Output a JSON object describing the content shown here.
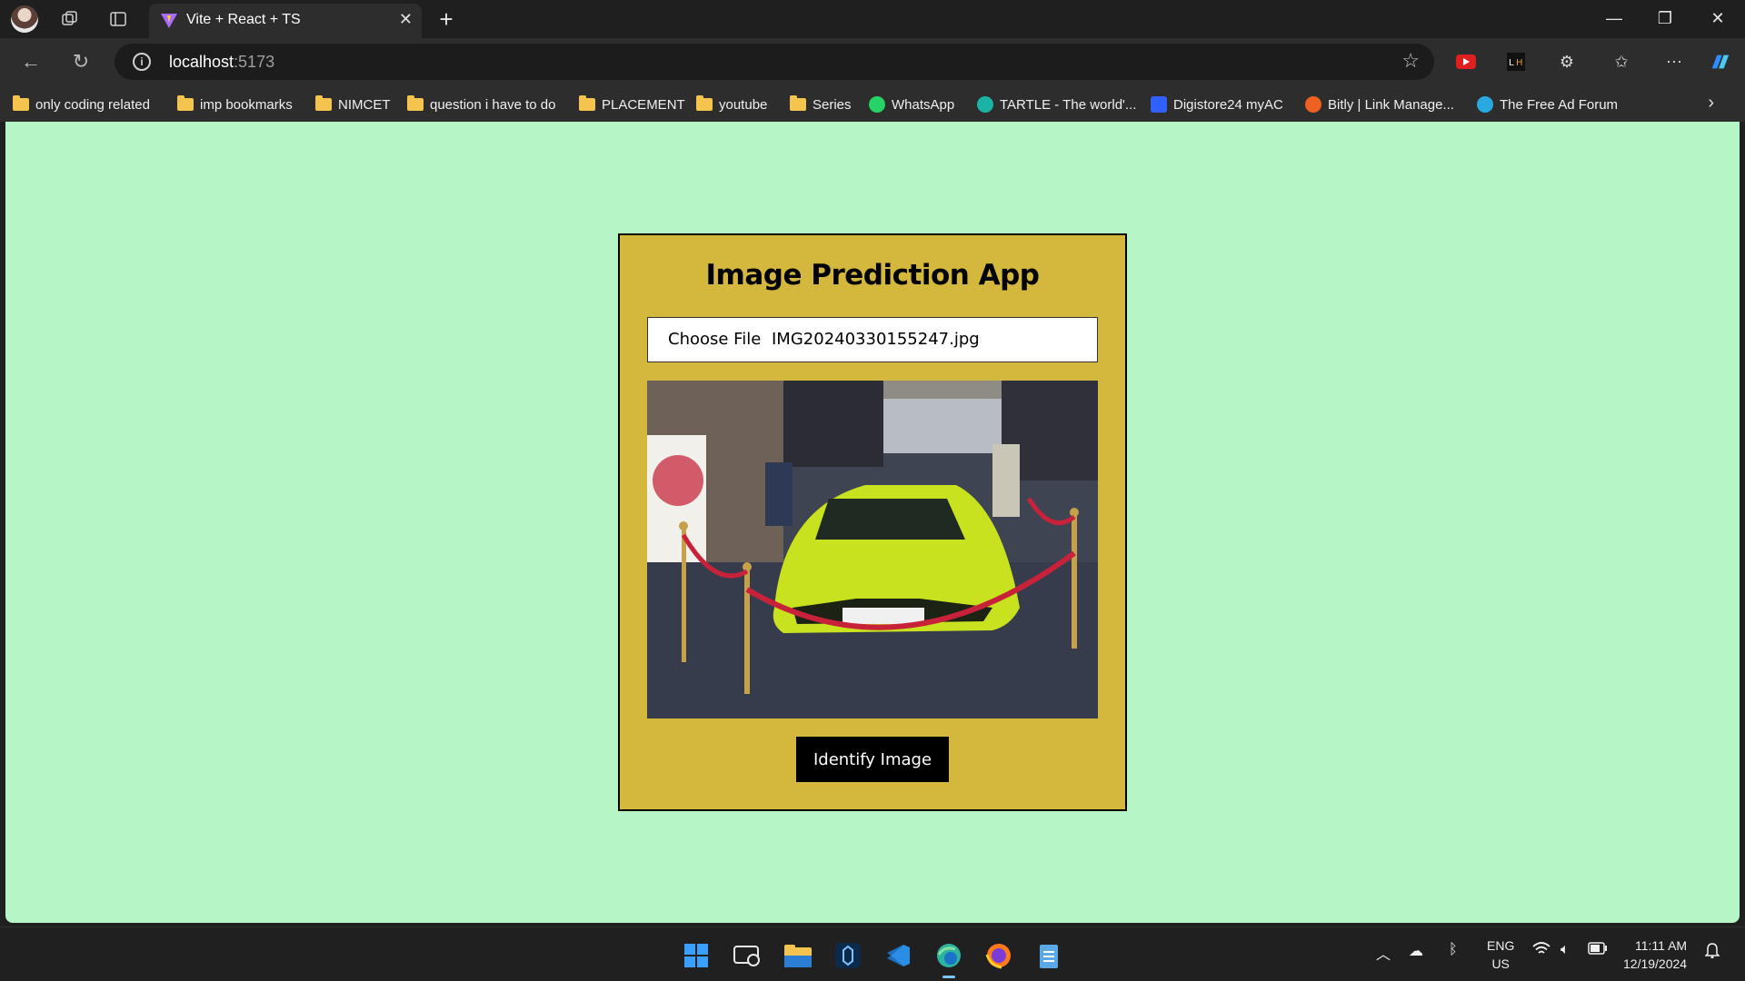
{
  "browser": {
    "tab_title": "Vite + React + TS",
    "url_host": "localhost",
    "url_port": ":5173"
  },
  "bookmarks": [
    {
      "label": "only coding  related",
      "icon": "folder-icon"
    },
    {
      "label": "imp bookmarks",
      "icon": "folder-icon"
    },
    {
      "label": "NIMCET",
      "icon": "folder-icon"
    },
    {
      "label": "question i have to do",
      "icon": "folder-icon"
    },
    {
      "label": "PLACEMENT",
      "icon": "folder-icon"
    },
    {
      "label": "youtube",
      "icon": "folder-icon"
    },
    {
      "label": "Series",
      "icon": "folder-icon"
    },
    {
      "label": "WhatsApp",
      "icon": "whatsapp-icon"
    },
    {
      "label": "TARTLE - The world'...",
      "icon": "tartle-icon"
    },
    {
      "label": "Digistore24 myAC",
      "icon": "digistore-icon"
    },
    {
      "label": "Bitly | Link Manage...",
      "icon": "bitly-icon"
    },
    {
      "label": "The Free Ad Forum",
      "icon": "freeadforum-icon"
    }
  ],
  "app": {
    "title": "Image Prediction App",
    "choose_file_label": "Choose File",
    "file_name": "IMG20240330155247.jpg",
    "identify_button": "Identify Image"
  },
  "taskbar": {
    "lang_line1": "ENG",
    "lang_line2": "US",
    "time": "11:11 AM",
    "date": "12/19/2024"
  },
  "colors": {
    "page_background": "#b5f5c6",
    "card_background": "#d4b83e",
    "button_background": "#000000"
  }
}
